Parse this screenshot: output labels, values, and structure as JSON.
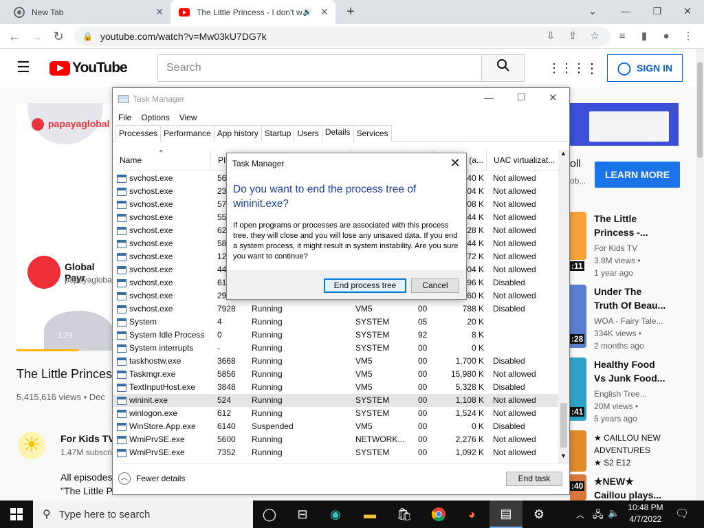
{
  "browser": {
    "tabs": [
      {
        "title": "New Tab"
      },
      {
        "title": "The Little Princess - I don't w"
      }
    ],
    "url": "youtube.com/watch?v=Mw03kU7DG7k"
  },
  "youtube": {
    "logo_text": "YouTube",
    "search_placeholder": "Search",
    "sign_in": "SIGN IN",
    "ad": {
      "brand": "papayaglobal",
      "channel": "Global Payr",
      "channel_sub": "papayaglobal",
      "duration": "1:29",
      "learn_more": "LEARN MORE",
      "side_text_1": "oll",
      "side_text_2": "ob..."
    },
    "video": {
      "title": "The Little Princes",
      "views": "5,415,616 views • Dec",
      "channel": "For Kids TV",
      "subs": "1.47M subscri",
      "desc_1": "All episodes",
      "desc_2": "\"The Little P"
    },
    "suggestions": [
      {
        "title_1": "The Little",
        "title_2": "Princess -...",
        "channel": "For Kids TV",
        "views": "3.8M views •",
        "age": "1 year ago",
        "duration": ":11",
        "thumb": "#f6a13a"
      },
      {
        "title_1": "Under The",
        "title_2": "Truth Of Beau...",
        "channel": "WOA - Fairy Tale...",
        "views": "334K views •",
        "age": "2 months ago",
        "duration": ":28",
        "thumb": "#5a7fd0"
      },
      {
        "title_1": "Healthy Food",
        "title_2": "Vs Junk Food...",
        "channel": "English Tree...",
        "views": "20M views •",
        "age": "5 years ago",
        "duration": ":41",
        "thumb": "#2fa2c9"
      },
      {
        "title_1": "★ CAILLOU NEW",
        "title_2": "ADVENTURES",
        "channel": "★ S2 E12",
        "views": "",
        "age": "",
        "duration": "",
        "thumb": "#e08a2c"
      },
      {
        "title_1": "★NEW★",
        "title_2": "Caillou plays...",
        "channel": "",
        "views": "",
        "age": "",
        "duration": ":40",
        "thumb": "#d8773a"
      }
    ]
  },
  "task_manager": {
    "title": "Task Manager",
    "menu": [
      "File",
      "Options",
      "View"
    ],
    "tabs": [
      "Processes",
      "Performance",
      "App history",
      "Startup",
      "Users",
      "Details",
      "Services"
    ],
    "active_tab": "Details",
    "columns": {
      "name": "Name",
      "pid": "PI",
      "memory": "y (a...",
      "uac": "UAC virtualizat..."
    },
    "rows": [
      {
        "name": "svchost.exe",
        "pid": "56",
        "status": "",
        "user": "",
        "cpu": "",
        "mem": "40 K",
        "uac": "Not allowed"
      },
      {
        "name": "svchost.exe",
        "pid": "23",
        "status": "",
        "user": "",
        "cpu": "",
        "mem": "04 K",
        "uac": "Not allowed"
      },
      {
        "name": "svchost.exe",
        "pid": "57",
        "status": "",
        "user": "",
        "cpu": "",
        "mem": "08 K",
        "uac": "Not allowed"
      },
      {
        "name": "svchost.exe",
        "pid": "55",
        "status": "",
        "user": "",
        "cpu": "",
        "mem": "44 K",
        "uac": "Not allowed"
      },
      {
        "name": "svchost.exe",
        "pid": "62",
        "status": "",
        "user": "",
        "cpu": "",
        "mem": "28 K",
        "uac": "Not allowed"
      },
      {
        "name": "svchost.exe",
        "pid": "58",
        "status": "",
        "user": "",
        "cpu": "",
        "mem": "44 K",
        "uac": "Not allowed"
      },
      {
        "name": "svchost.exe",
        "pid": "12",
        "status": "",
        "user": "",
        "cpu": "",
        "mem": "72 K",
        "uac": "Not allowed"
      },
      {
        "name": "svchost.exe",
        "pid": "44",
        "status": "",
        "user": "",
        "cpu": "",
        "mem": "04 K",
        "uac": "Not allowed"
      },
      {
        "name": "svchost.exe",
        "pid": "61",
        "status": "",
        "user": "",
        "cpu": "",
        "mem": "96 K",
        "uac": "Disabled"
      },
      {
        "name": "svchost.exe",
        "pid": "29",
        "status": "",
        "user": "",
        "cpu": "",
        "mem": "60 K",
        "uac": "Not allowed"
      },
      {
        "name": "svchost.exe",
        "pid": "7928",
        "status": "Running",
        "user": "VM5",
        "cpu": "00",
        "mem": "788 K",
        "uac": "Disabled"
      },
      {
        "name": "System",
        "pid": "4",
        "status": "Running",
        "user": "SYSTEM",
        "cpu": "05",
        "mem": "20 K",
        "uac": ""
      },
      {
        "name": "System Idle Process",
        "pid": "0",
        "status": "Running",
        "user": "SYSTEM",
        "cpu": "92",
        "mem": "8 K",
        "uac": ""
      },
      {
        "name": "System interrupts",
        "pid": "-",
        "status": "Running",
        "user": "SYSTEM",
        "cpu": "00",
        "mem": "0 K",
        "uac": ""
      },
      {
        "name": "taskhostw.exe",
        "pid": "3668",
        "status": "Running",
        "user": "VM5",
        "cpu": "00",
        "mem": "1,700 K",
        "uac": "Disabled"
      },
      {
        "name": "Taskmgr.exe",
        "pid": "5856",
        "status": "Running",
        "user": "VM5",
        "cpu": "00",
        "mem": "15,980 K",
        "uac": "Not allowed"
      },
      {
        "name": "TextInputHost.exe",
        "pid": "3848",
        "status": "Running",
        "user": "VM5",
        "cpu": "00",
        "mem": "5,328 K",
        "uac": "Disabled"
      },
      {
        "name": "wininit.exe",
        "pid": "524",
        "status": "Running",
        "user": "SYSTEM",
        "cpu": "00",
        "mem": "1,108 K",
        "uac": "Not allowed"
      },
      {
        "name": "winlogon.exe",
        "pid": "612",
        "status": "Running",
        "user": "SYSTEM",
        "cpu": "00",
        "mem": "1,524 K",
        "uac": "Not allowed"
      },
      {
        "name": "WinStore.App.exe",
        "pid": "6140",
        "status": "Suspended",
        "user": "VM5",
        "cpu": "00",
        "mem": "0 K",
        "uac": "Disabled"
      },
      {
        "name": "WmiPrvSE.exe",
        "pid": "5600",
        "status": "Running",
        "user": "NETWORK...",
        "cpu": "00",
        "mem": "2,276 K",
        "uac": "Not allowed"
      },
      {
        "name": "WmiPrvSE.exe",
        "pid": "7352",
        "status": "Running",
        "user": "SYSTEM",
        "cpu": "00",
        "mem": "1,092 K",
        "uac": "Not allowed"
      }
    ],
    "selected_row": "wininit.exe",
    "fewer_details": "Fewer details",
    "end_task": "End task"
  },
  "dialog": {
    "title": "Task Manager",
    "question": "Do you want to end the process tree of wininit.exe?",
    "message": "If open programs or processes are associated with this process tree, they will close and you will lose any unsaved data. If you end a system process, it might result in system instability. Are you sure you want to continue?",
    "confirm": "End process tree",
    "cancel": "Cancel"
  },
  "taskbar": {
    "search_placeholder": "Type here to search",
    "time": "10:48 PM",
    "date": "4/7/2022"
  }
}
